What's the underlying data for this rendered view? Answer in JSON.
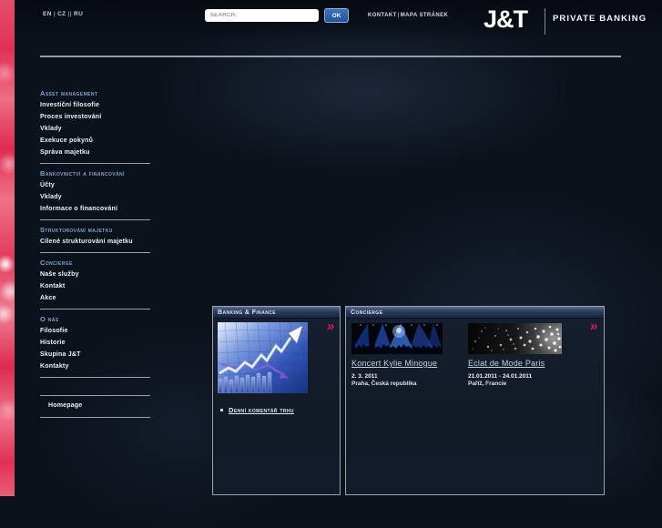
{
  "colors": {
    "accent_pink": "#e0195c",
    "section_title_blue": "#7fa3d4",
    "ok_button_blue": "#2d63aa",
    "background_navy": "#0c121c"
  },
  "header": {
    "languages": {
      "en": "EN",
      "cz": "CZ",
      "ru": "RU",
      "sep_single": "|",
      "sep_double": "||"
    },
    "search": {
      "placeholder": "SEARCH:",
      "ok_label": "OK"
    },
    "top_links": {
      "contact": "KONTAKT",
      "separator": "|",
      "sitemap": "MAPA STRÁNEK"
    },
    "logo": {
      "brand": "J&T",
      "tagline": "PRIVATE BANKING"
    }
  },
  "sidebar": {
    "sections": [
      {
        "title": "Asset management",
        "items": [
          "Investiční filosofie",
          "Proces investování",
          "Vklady",
          "Exekuce pokynů",
          "Správa majetku"
        ]
      },
      {
        "title": "Bankovnictví a financování",
        "items": [
          "Účty",
          "Vklady",
          "Informace o financování"
        ]
      },
      {
        "title": "Strukturování majetku",
        "items": [
          "Cílené strukturování majetku"
        ]
      },
      {
        "title": "Concierge",
        "items": [
          "Naše služby",
          "Kontakt",
          "Akce"
        ]
      },
      {
        "title": "O nás",
        "items": [
          "Filosofie",
          "Historie",
          "Skupina J&T",
          "Kontakty"
        ]
      }
    ],
    "homepage_label": "Homepage"
  },
  "banking_panel": {
    "title": "Banking & Finance",
    "more_glyph": "»",
    "link": "Denní komentář trhu"
  },
  "concierge_panel": {
    "title": "Concierge",
    "more_glyph": "»",
    "events": [
      {
        "title": "Koncert Kylie Minogue",
        "date": "2. 3. 2011",
        "location": "Praha, Česká republika"
      },
      {
        "title": "Eclat de Mode Paris",
        "date": "21.01.2011 - 24.01.2011",
        "location": "Paříž, Francie"
      }
    ]
  }
}
